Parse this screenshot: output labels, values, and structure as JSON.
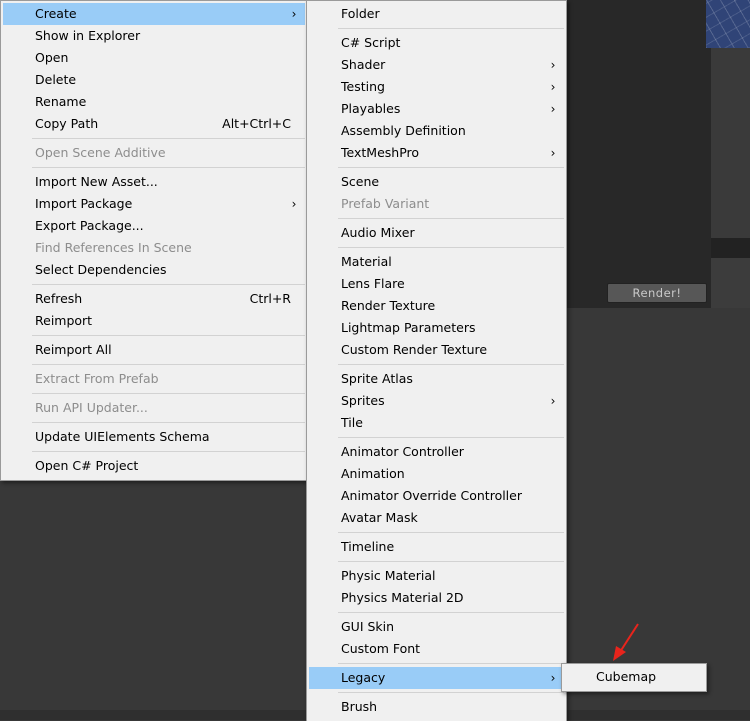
{
  "editor_background": {
    "render_button": "Render!"
  },
  "context_menu": {
    "items": [
      {
        "label": "Create",
        "submenu": true,
        "highlighted": true
      },
      {
        "label": "Show in Explorer"
      },
      {
        "label": "Open"
      },
      {
        "label": "Delete"
      },
      {
        "label": "Rename"
      },
      {
        "label": "Copy Path",
        "shortcut": "Alt+Ctrl+C"
      },
      {
        "label": "Open Scene Additive",
        "disabled": true
      },
      {
        "label": "Import New Asset..."
      },
      {
        "label": "Import Package",
        "submenu": true
      },
      {
        "label": "Export Package..."
      },
      {
        "label": "Find References In Scene",
        "disabled": true
      },
      {
        "label": "Select Dependencies"
      },
      {
        "label": "Refresh",
        "shortcut": "Ctrl+R"
      },
      {
        "label": "Reimport"
      },
      {
        "label": "Reimport All"
      },
      {
        "label": "Extract From Prefab",
        "disabled": true
      },
      {
        "label": "Run API Updater...",
        "disabled": true
      },
      {
        "label": "Update UIElements Schema"
      },
      {
        "label": "Open C# Project"
      }
    ]
  },
  "create_submenu": {
    "items": [
      {
        "label": "Folder"
      },
      {
        "label": "C# Script"
      },
      {
        "label": "Shader",
        "submenu": true
      },
      {
        "label": "Testing",
        "submenu": true
      },
      {
        "label": "Playables",
        "submenu": true
      },
      {
        "label": "Assembly Definition"
      },
      {
        "label": "TextMeshPro",
        "submenu": true
      },
      {
        "label": "Scene"
      },
      {
        "label": "Prefab Variant",
        "disabled": true
      },
      {
        "label": "Audio Mixer"
      },
      {
        "label": "Material"
      },
      {
        "label": "Lens Flare"
      },
      {
        "label": "Render Texture"
      },
      {
        "label": "Lightmap Parameters"
      },
      {
        "label": "Custom Render Texture"
      },
      {
        "label": "Sprite Atlas"
      },
      {
        "label": "Sprites",
        "submenu": true
      },
      {
        "label": "Tile"
      },
      {
        "label": "Animator Controller"
      },
      {
        "label": "Animation"
      },
      {
        "label": "Animator Override Controller"
      },
      {
        "label": "Avatar Mask"
      },
      {
        "label": "Timeline"
      },
      {
        "label": "Physic Material"
      },
      {
        "label": "Physics Material 2D"
      },
      {
        "label": "GUI Skin"
      },
      {
        "label": "Custom Font"
      },
      {
        "label": "Legacy",
        "submenu": true,
        "highlighted": true
      },
      {
        "label": "Brush"
      }
    ]
  },
  "legacy_submenu": {
    "items": [
      {
        "label": "Cubemap"
      }
    ]
  },
  "icons": {
    "submenu_arrow": "›"
  },
  "colors": {
    "menu_bg": "#f0f0f0",
    "highlight": "#99ccf7",
    "disabled_text": "#8d8d8d",
    "editor_bg": "#383838",
    "annotation_arrow": "#e8241c"
  }
}
